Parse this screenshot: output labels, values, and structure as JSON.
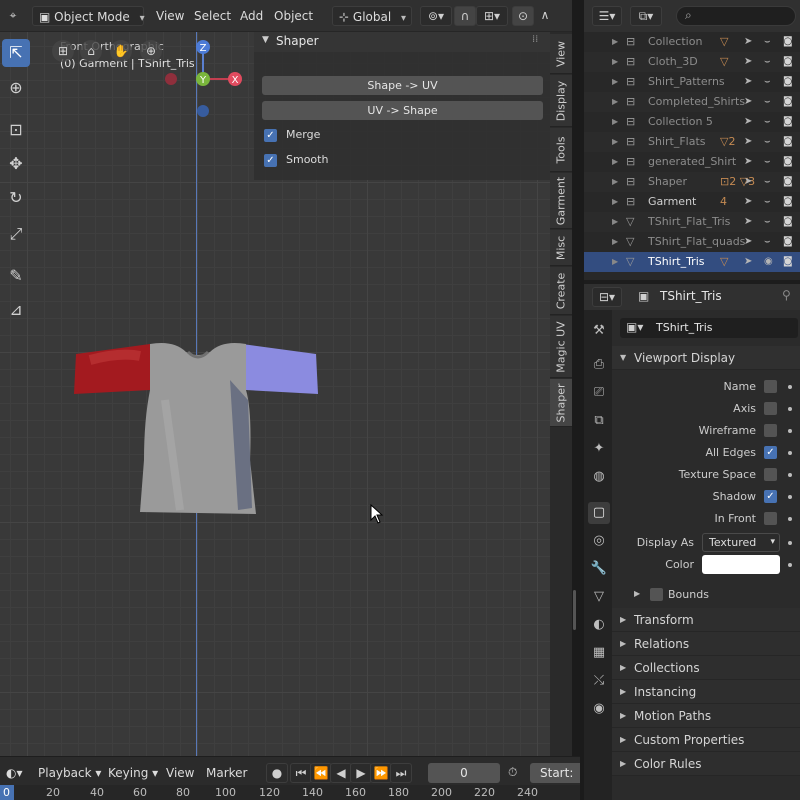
{
  "header": {
    "mode": "Object Mode",
    "menus": [
      "View",
      "Select",
      "Add",
      "Object"
    ],
    "transform_orientation": "Global"
  },
  "viewport": {
    "view_label": "Front Orthographic",
    "object_label": "(0) Garment | TShirt_Tris",
    "gizmo": {
      "z": "Z",
      "y": "Y",
      "x": "X"
    }
  },
  "shaper_panel": {
    "title": "Shaper",
    "shape_to_uv": "Shape -> UV",
    "uv_to_shape": "UV -> Shape",
    "merge": "Merge",
    "smooth": "Smooth"
  },
  "sidebar_tabs": [
    "View",
    "Display",
    "Tools",
    "Garment",
    "Misc",
    "Create",
    "Magic UV",
    "Shaper"
  ],
  "timeline": {
    "playback": "Playback",
    "keying": "Keying",
    "view": "View",
    "marker": "Marker",
    "frame": "0",
    "start_label": "Start:",
    "ticks": [
      "0",
      "20",
      "40",
      "60",
      "80",
      "100",
      "120",
      "140",
      "160",
      "180",
      "200",
      "220",
      "240"
    ]
  },
  "outliner": {
    "items": [
      {
        "name": "Collection",
        "icon": "collection-icon",
        "extra": "▽"
      },
      {
        "name": "Cloth_3D",
        "icon": "collection-icon",
        "extra": "▽"
      },
      {
        "name": "Shirt_Patterns",
        "icon": "collection-icon",
        "extra": ""
      },
      {
        "name": "Completed_Shirts",
        "icon": "collection-icon",
        "extra": ""
      },
      {
        "name": "Collection 5",
        "icon": "collection-icon",
        "extra": ""
      },
      {
        "name": "Shirt_Flats",
        "icon": "collection-icon",
        "extra": "▽2"
      },
      {
        "name": "generated_Shirt",
        "icon": "collection-icon",
        "extra": ""
      },
      {
        "name": "Shaper",
        "icon": "collection-icon",
        "extra": "⊡2 ▽3"
      },
      {
        "name": "Garment",
        "icon": "collection-icon",
        "extra": "4"
      },
      {
        "name": "TShirt_Flat_Tris",
        "icon": "mesh-icon",
        "extra": ""
      },
      {
        "name": "TShirt_Flat_quads",
        "icon": "mesh-icon",
        "extra": ""
      },
      {
        "name": "TShirt_Tris",
        "icon": "mesh-icon",
        "extra": "▽"
      }
    ]
  },
  "properties": {
    "object_name": "TShirt_Tris",
    "data_name": "TShirt_Tris",
    "viewport_display": "Viewport Display",
    "rows": [
      {
        "label": "Name",
        "checked": false
      },
      {
        "label": "Axis",
        "checked": false
      },
      {
        "label": "Wireframe",
        "checked": false
      },
      {
        "label": "All Edges",
        "checked": true
      },
      {
        "label": "Texture Space",
        "checked": false
      },
      {
        "label": "Shadow",
        "checked": true
      },
      {
        "label": "In Front",
        "checked": false
      }
    ],
    "display_as_label": "Display As",
    "display_as_value": "Textured",
    "color_label": "Color",
    "color_value": "#ffffff",
    "bounds": "Bounds",
    "sections": [
      "Transform",
      "Relations",
      "Collections",
      "Instancing",
      "Motion Paths",
      "Custom Properties",
      "Color Rules"
    ]
  }
}
